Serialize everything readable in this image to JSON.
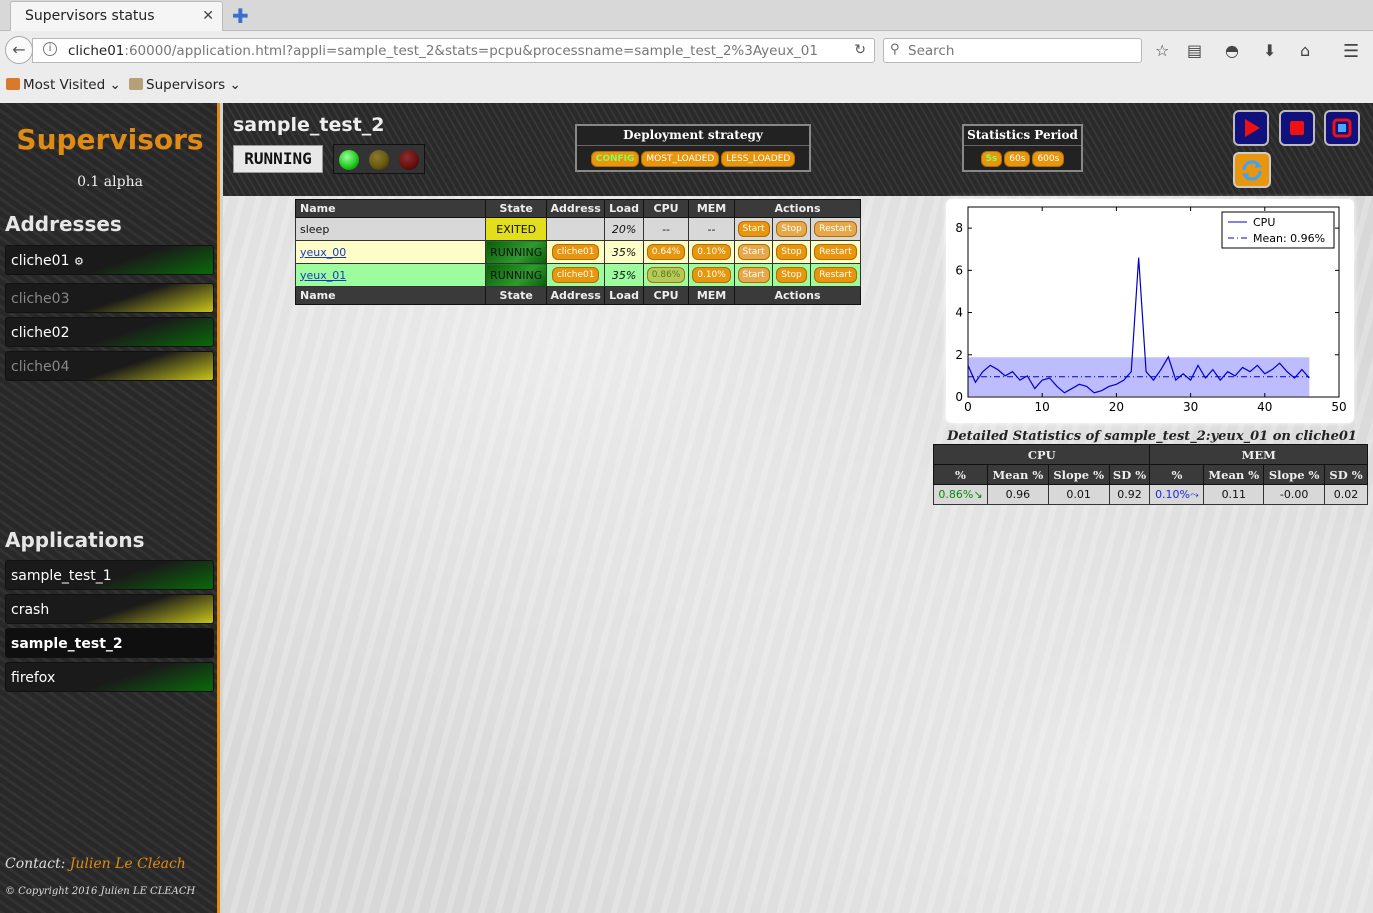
{
  "browser": {
    "tab_title": "Supervisors status",
    "url_host": "cliche01",
    "url_rest": ":60000/application.html?appli=sample_test_2&stats=pcpu&processname=sample_test_2%3Ayeux_01",
    "search_placeholder": "Search",
    "bookmarks": [
      "Most Visited",
      "Supervisors"
    ]
  },
  "sidebar": {
    "title": "Supervisors",
    "version": "0.1 alpha",
    "addresses_heading": "Addresses",
    "addresses": [
      {
        "label": "cliche01",
        "state": "running",
        "current": true
      },
      {
        "label": "cliche03",
        "state": "warning"
      },
      {
        "label": "cliche02",
        "state": "running"
      },
      {
        "label": "cliche04",
        "state": "warning"
      }
    ],
    "applications_heading": "Applications",
    "applications": [
      {
        "label": "sample_test_1",
        "state": "running"
      },
      {
        "label": "crash",
        "state": "warning"
      },
      {
        "label": "sample_test_2",
        "state": "selected"
      },
      {
        "label": "firefox",
        "state": "running"
      }
    ],
    "contact_label": "Contact:",
    "contact_name": "Julien Le Cléach",
    "copyright": "© Copyright 2016 Julien LE CLEACH"
  },
  "header": {
    "app_name": "sample_test_2",
    "state": "RUNNING",
    "lights": {
      "green": "#22cc22",
      "yellow": "#6a5a10",
      "red": "#6a1010"
    },
    "deployment": {
      "title": "Deployment strategy",
      "options": [
        "CONFIG",
        "MOST_LOADED",
        "LESS_LOADED"
      ],
      "selected": "CONFIG"
    },
    "stats_period": {
      "title": "Statistics Period",
      "options": [
        "5s",
        "60s",
        "600s"
      ],
      "selected": "5s"
    }
  },
  "process_table": {
    "headers": [
      "Name",
      "State",
      "Address",
      "Load",
      "CPU",
      "MEM",
      "Actions"
    ],
    "rows": [
      {
        "name": "sleep",
        "state": "EXITED",
        "address": "",
        "load": "20%",
        "cpu": "--",
        "mem": "--",
        "actions": [
          "Start",
          "Stop",
          "Restart"
        ]
      },
      {
        "name": "yeux_00",
        "state": "RUNNING",
        "address": "cliche01",
        "load": "35%",
        "cpu": "0.64%",
        "mem": "0.10%",
        "actions": [
          "Start",
          "Stop",
          "Restart"
        ]
      },
      {
        "name": "yeux_01",
        "state": "RUNNING",
        "address": "cliche01",
        "load": "35%",
        "cpu": "0.86%",
        "mem": "0.10%",
        "actions": [
          "Start",
          "Stop",
          "Restart"
        ]
      }
    ]
  },
  "chart_data": {
    "type": "line",
    "series": [
      {
        "name": "CPU",
        "x": [
          0,
          1,
          2,
          3,
          4,
          5,
          6,
          7,
          8,
          9,
          10,
          11,
          12,
          13,
          14,
          15,
          16,
          17,
          18,
          19,
          20,
          21,
          22,
          23,
          24,
          25,
          26,
          27,
          28,
          29,
          30,
          31,
          32,
          33,
          34,
          35,
          36,
          37,
          38,
          39,
          40,
          41,
          42,
          43,
          44,
          45,
          46
        ],
        "y": [
          1.5,
          0.7,
          1.2,
          1.5,
          1.3,
          1.0,
          1.2,
          0.8,
          1.0,
          0.4,
          0.8,
          0.9,
          0.5,
          0.2,
          0.4,
          0.6,
          0.5,
          0.2,
          0.3,
          0.5,
          0.6,
          0.8,
          1.2,
          6.6,
          1.2,
          0.8,
          1.3,
          1.9,
          0.8,
          1.1,
          0.8,
          1.5,
          0.9,
          1.3,
          0.8,
          1.2,
          1.0,
          1.4,
          1.2,
          1.5,
          1.1,
          1.3,
          1.6,
          1.2,
          0.9,
          1.3,
          0.9
        ]
      }
    ],
    "legend": [
      "CPU",
      "Mean: 0.96%"
    ],
    "mean": 0.96,
    "sd": 0.92,
    "xlim": [
      0,
      50
    ],
    "ylim": [
      0,
      9
    ],
    "xticks": [
      0,
      10,
      20,
      30,
      40,
      50
    ],
    "yticks": [
      0,
      2,
      4,
      6,
      8
    ],
    "legend_position": "top-right",
    "line_color": "#0000cc",
    "band_color": "#b0b0ff"
  },
  "detail_stats": {
    "title": "Detailed Statistics of sample_test_2:yeux_01 on cliche01",
    "groups": [
      "CPU",
      "MEM"
    ],
    "columns": [
      "%",
      "Mean %",
      "Slope %",
      "SD %",
      "%",
      "Mean %",
      "Slope %",
      "SD %"
    ],
    "values": [
      "0.86%↘",
      "0.96",
      "0.01",
      "0.92",
      "0.10%⤳",
      "0.11",
      "-0.00",
      "0.02"
    ]
  }
}
